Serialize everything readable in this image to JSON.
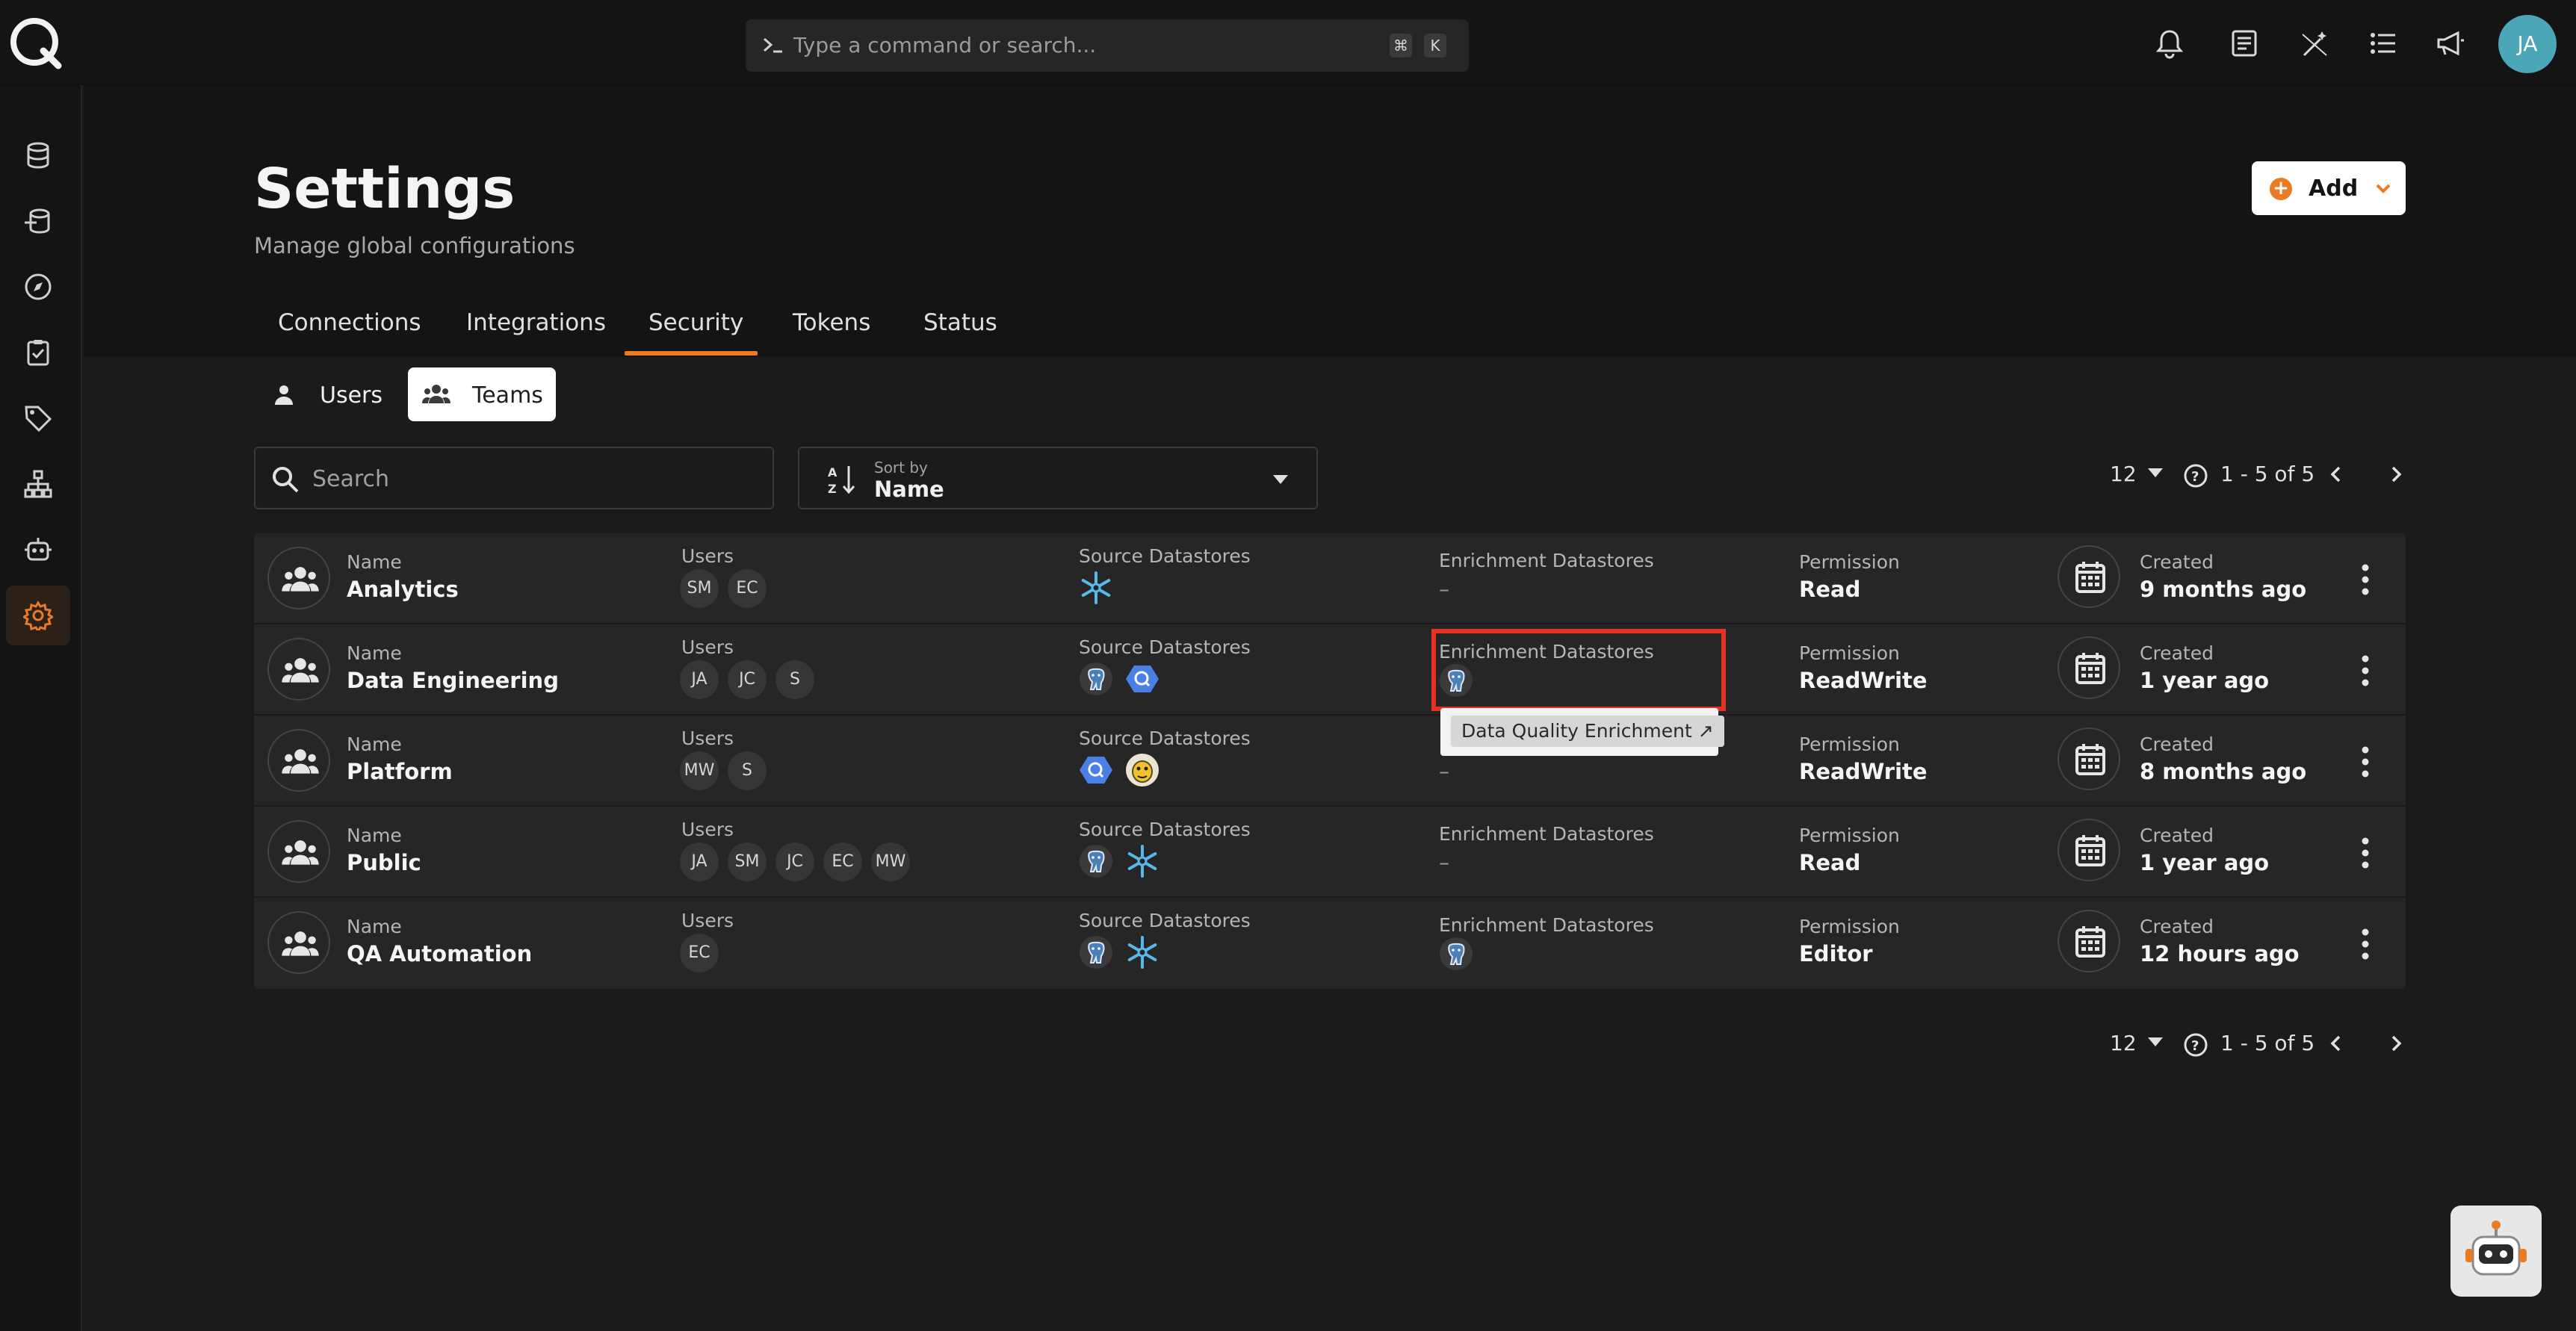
{
  "command_bar": {
    "placeholder": "Type a command or search...",
    "key1": "⌘",
    "key2": "K"
  },
  "user": {
    "initials": "JA"
  },
  "page": {
    "title": "Settings",
    "subtitle": "Manage global configurations"
  },
  "add_button": {
    "label": "Add"
  },
  "tabs": [
    "Connections",
    "Integrations",
    "Security",
    "Tokens",
    "Status"
  ],
  "active_tab": "Security",
  "subtabs": {
    "users": "Users",
    "teams": "Teams",
    "active": "Teams"
  },
  "search": {
    "placeholder": "Search"
  },
  "sort": {
    "caption": "Sort by",
    "value": "Name"
  },
  "pagination": {
    "page_size": "12",
    "range": "1 - 5 of 5"
  },
  "labels": {
    "name": "Name",
    "users": "Users",
    "source": "Source Datastores",
    "enrichment": "Enrichment Datastores",
    "permission": "Permission",
    "created": "Created",
    "empty": "–"
  },
  "teams": [
    {
      "name": "Analytics",
      "users": [
        "SM",
        "EC"
      ],
      "sources": [
        "snowflake"
      ],
      "enrichment": [],
      "permission": "Read",
      "created": "9 months ago"
    },
    {
      "name": "Data Engineering",
      "users": [
        "JA",
        "JC",
        "S"
      ],
      "sources": [
        "postgres",
        "bigquery"
      ],
      "enrichment": [
        "postgres"
      ],
      "permission": "ReadWrite",
      "created": "1 year ago"
    },
    {
      "name": "Platform",
      "users": [
        "MW",
        "S"
      ],
      "sources": [
        "bigquery",
        "hive"
      ],
      "enrichment": [],
      "permission": "ReadWrite",
      "created": "8 months ago"
    },
    {
      "name": "Public",
      "users": [
        "JA",
        "SM",
        "JC",
        "EC",
        "MW"
      ],
      "sources": [
        "postgres",
        "snowflake"
      ],
      "enrichment": [],
      "permission": "Read",
      "created": "1 year ago"
    },
    {
      "name": "QA Automation",
      "users": [
        "EC"
      ],
      "sources": [
        "postgres",
        "snowflake"
      ],
      "enrichment": [
        "postgres"
      ],
      "permission": "Editor",
      "created": "12 hours ago"
    }
  ],
  "tooltip": {
    "text": "Data Quality Enrichment ↗"
  },
  "colors": {
    "accent": "#ea7a23",
    "highlight": "#e43323",
    "avatar": "#4ba6b7"
  }
}
